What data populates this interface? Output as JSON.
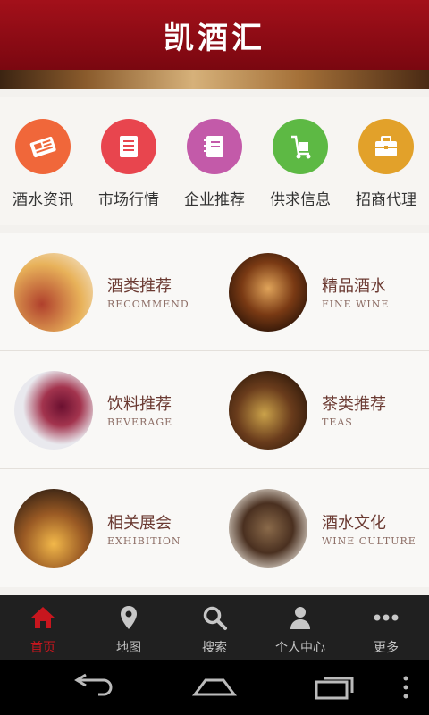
{
  "app": {
    "title": "凯酒汇"
  },
  "categories": [
    {
      "label": "酒水资讯",
      "icon": "newspaper-icon",
      "color": "#f0673a"
    },
    {
      "label": "市场行情",
      "icon": "document-icon",
      "color": "#e8454e"
    },
    {
      "label": "企业推荐",
      "icon": "notebook-icon",
      "color": "#c35aa9"
    },
    {
      "label": "供求信息",
      "icon": "hand-truck-icon",
      "color": "#5db944"
    },
    {
      "label": "招商代理",
      "icon": "briefcase-icon",
      "color": "#e2a12a"
    }
  ],
  "sections": [
    {
      "cn": "酒类推荐",
      "en": "RECOMMEND"
    },
    {
      "cn": "精品酒水",
      "en": "FINE WINE"
    },
    {
      "cn": "饮料推荐",
      "en": "BEVERAGE"
    },
    {
      "cn": "茶类推荐",
      "en": "TEAS"
    },
    {
      "cn": "相关展会",
      "en": "EXHIBITION"
    },
    {
      "cn": "酒水文化",
      "en": "WINE CULTURE"
    }
  ],
  "tabs": [
    {
      "label": "首页",
      "icon": "home-icon",
      "active": true
    },
    {
      "label": "地图",
      "icon": "map-pin-icon",
      "active": false
    },
    {
      "label": "搜索",
      "icon": "search-icon",
      "active": false
    },
    {
      "label": "个人中心",
      "icon": "person-icon",
      "active": false
    },
    {
      "label": "更多",
      "icon": "more-dots-icon",
      "active": false
    }
  ],
  "colors": {
    "accent": "#c8161e",
    "header": "#8b0b14",
    "tabbar": "#202020"
  }
}
